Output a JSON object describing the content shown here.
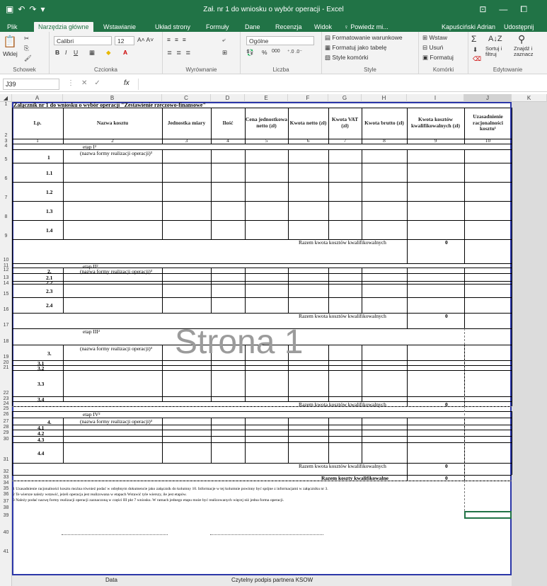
{
  "window": {
    "title": "Zał. nr 1 do wniosku o wybór operacji - Excel"
  },
  "ribbon_tabs": [
    "Plik",
    "Narzędzia główne",
    "Wstawianie",
    "Układ strony",
    "Formuły",
    "Dane",
    "Recenzja",
    "Widok",
    "♀ Powiedz mi..."
  ],
  "active_tab": "Narzędzia główne",
  "user": "Kapuściński Adrian",
  "share": "Udostępnij",
  "ribbon": {
    "clipboard": {
      "paste": "Wklej",
      "label": "Schowek"
    },
    "font": {
      "name": "Calibri",
      "size": "12",
      "label": "Czcionka"
    },
    "alignment": {
      "label": "Wyrównanie"
    },
    "number": {
      "format": "Ogólne",
      "label": "Liczba",
      "percent": "%",
      "thousands": "000"
    },
    "styles": {
      "cond": "Formatowanie warunkowe",
      "table": "Formatuj jako tabelę",
      "cell": "Style komórki",
      "label": "Style"
    },
    "cells": {
      "insert": "Wstaw",
      "delete": "Usuń",
      "format": "Formatuj",
      "label": "Komórki"
    },
    "editing": {
      "sort": "Sortuj i filtruj",
      "find": "Znajdź i zaznacz",
      "label": "Edytowanie"
    }
  },
  "formula_bar": {
    "name_box": "J39",
    "fx": "fx",
    "value": ""
  },
  "columns": [
    "A",
    "B",
    "C",
    "D",
    "E",
    "F",
    "G",
    "H",
    "I",
    "J",
    "K"
  ],
  "sheet": {
    "title": "Załącznik nr 1 do wniosku o wybór operacji \"Zestawienie rzeczowo-finansowe\"",
    "headers": [
      "Lp.",
      "Nazwa kosztu",
      "Jednostka miary",
      "Ilość",
      "Cena jednostkowa netto (zł)",
      "Kwota netto (zł)",
      "Kwota VAT (zł)",
      "Kwota brutto (zł)",
      "Kwota kosztów kwalifikowalnych (zł)",
      "Uzasadnienie racjonalności kosztu¹"
    ],
    "numbers": [
      "1",
      "2",
      "3",
      "4",
      "5",
      "6",
      "7",
      "8",
      "9",
      "10"
    ],
    "stages": [
      {
        "label": "etap I²",
        "num": "1",
        "form": "(nazwa formy realizacji operacji)³",
        "items": [
          "1.1",
          "1.2",
          "1.3",
          "1.4"
        ],
        "sum_label": "Razem kwota kosztów kwalifikowalnych",
        "sum": "0"
      },
      {
        "label": "etap II²",
        "num": "2.",
        "form": "(nazwa formy realizacji operacji)³",
        "items": [
          "2.1",
          "2.2",
          "2.3",
          "2.4"
        ],
        "sum_label": "Razem kwota kosztów kwalifikowalnych",
        "sum": "0"
      },
      {
        "label": "etap III²",
        "num": "3.",
        "form": "(nazwa formy realizacji operacji)³",
        "items": [
          "3.1",
          "3.2",
          "3.3",
          "3.4"
        ],
        "sum_label": "Razem kwota kosztów kwalifikowalnych",
        "sum": "0"
      },
      {
        "label": "etap IV²",
        "num": "4.",
        "form": "(nazwa formy realizacji operacji)³",
        "items": [
          "4.1",
          "4.2",
          "4.3",
          "4.4"
        ],
        "sum_label": "Razem kwota kosztów kwalifikowalnych",
        "sum": "0"
      }
    ],
    "total_label": "Razem koszty kwalifikowalne",
    "total": "0",
    "watermark": "Strona 1",
    "notes": [
      "1 Uzasadnienie racjonalności kosztu można również podać w odrębnym dokumencie jako załącznik do kolumny 10. Informacje w tej kolumnie powinny być spójne z informacjami w załączniku nr 3.",
      "2 Te wiersze należy wstawić, jeżeli operacja jest realizowana w etapach Wstawić tyle wierszy, ile jest etapów.",
      "3 Należy podać nazwę formy realizacji operacji zaznaczoną w części III pkt 7 wniosku. W ramach jednego etapu może być realizowanych więcej niż jedna forma operacji."
    ],
    "footer": {
      "date": "Data",
      "signature": "Czytelny podpis partnera KSOW"
    }
  }
}
